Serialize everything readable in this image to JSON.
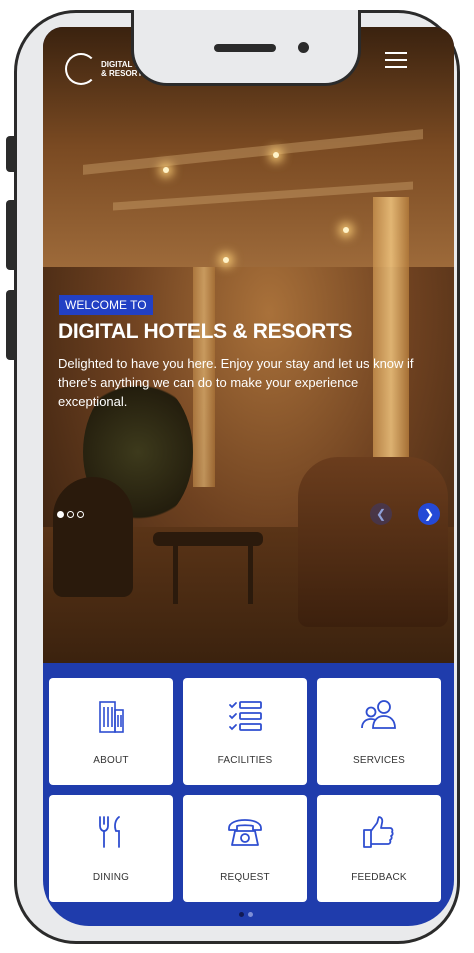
{
  "app": {
    "logo_text": "DIGITAL HOTELS\n& RESORTS"
  },
  "hero": {
    "tag": "WELCOME TO",
    "title": "DIGITAL HOTELS & RESORTS",
    "text": "Delighted to have you here. Enjoy your stay and let us know if there's anything we can do to make your experience exceptional.",
    "prev_icon": "chevron-left",
    "next_icon": "chevron-right",
    "slides": 3,
    "active_slide": 1
  },
  "menu": [
    {
      "label": "ABOUT",
      "icon": "building-icon"
    },
    {
      "label": "FACILITIES",
      "icon": "checklist-icon"
    },
    {
      "label": "SERVICES",
      "icon": "people-icon"
    },
    {
      "label": "DINING",
      "icon": "cutlery-icon"
    },
    {
      "label": "REQUEST",
      "icon": "phone-icon"
    },
    {
      "label": "FEEDBACK",
      "icon": "thumbs-up-icon"
    }
  ],
  "pager": {
    "pages": 2,
    "active": 1
  },
  "colors": {
    "accent": "#2240c4",
    "icon": "#2f4ed0",
    "background": "#1f3cac"
  }
}
